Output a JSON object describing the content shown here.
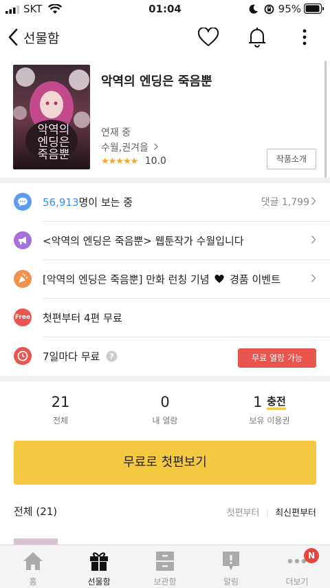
{
  "status_bar": {
    "carrier": "SKT",
    "time": "01:04",
    "battery": "95%"
  },
  "nav": {
    "title": "선물함",
    "icons": [
      "back-icon",
      "heart-icon",
      "bell-icon",
      "more-icon"
    ]
  },
  "work": {
    "title": "악역의 엔딩은 죽음뿐",
    "status": "연재 중",
    "author": "수월,권겨을",
    "stars": "★★★★★",
    "rating": "10.0",
    "intro_button": "작품소개",
    "cover_text": [
      "악역의",
      "엔딩은",
      "죽음뿐"
    ]
  },
  "rows": {
    "viewers_count": "56,913",
    "viewers_suffix": "명이 보는 중",
    "comments": "댓글 1,799",
    "notice1": "<악역의 엔딩은 죽음뿐> 웹툰작가 수월입니다",
    "notice2_a": "[악역의 엔딩은 죽음뿐] 만화 런칭 기념",
    "notice2_b": "경품 이벤트",
    "free_badge_icon": "Free",
    "free_text": "첫편부터 4편 무료",
    "wait_text": "7일마다 무료",
    "wait_badge": "무료 열람 가능"
  },
  "counts": [
    {
      "num": "21",
      "label": "전체"
    },
    {
      "num": "0",
      "label": "내 열람"
    },
    {
      "num": "1",
      "extra": "충전",
      "label": "보유 이용권"
    }
  ],
  "cta": "무료로 첫편보기",
  "list": {
    "header": "전체 (21)",
    "sort_first": "첫편부터",
    "sort_latest": "최신편부터"
  },
  "tabs": [
    {
      "label": "홈",
      "icon": "home-icon"
    },
    {
      "label": "선물함",
      "icon": "gift-icon",
      "active": true
    },
    {
      "label": "보관함",
      "icon": "cabinet-icon"
    },
    {
      "label": "알림",
      "icon": "notification-icon"
    },
    {
      "label": "더보기",
      "icon": "more-icon"
    }
  ],
  "tab_badge": "N",
  "colors": {
    "accent": "#f5c842",
    "blue": "#3b8ef0",
    "red": "#e8564f",
    "purple": "#a572d8",
    "orange": "#f0914d"
  }
}
